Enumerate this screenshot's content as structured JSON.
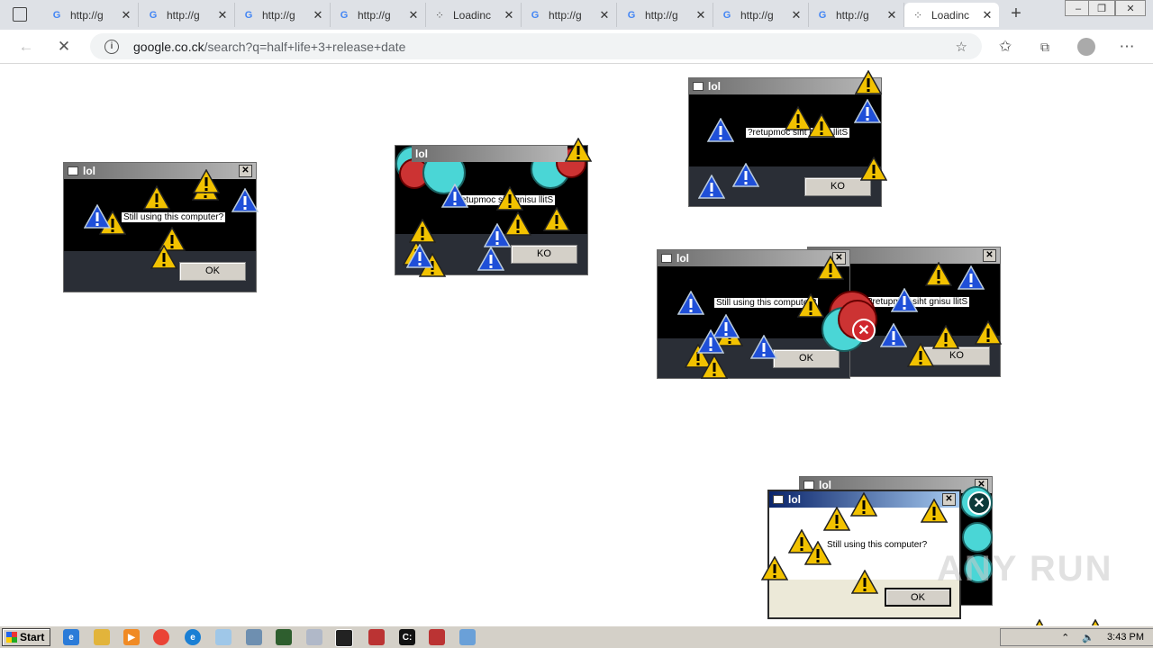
{
  "browser": {
    "tabs": [
      {
        "title": "http://g",
        "icon": "google-icon"
      },
      {
        "title": "http://g",
        "icon": "google-icon"
      },
      {
        "title": "http://g",
        "icon": "google-icon"
      },
      {
        "title": "http://g",
        "icon": "google-icon"
      },
      {
        "title": "Loadinc",
        "icon": "loading-icon"
      },
      {
        "title": "http://g",
        "icon": "google-icon"
      },
      {
        "title": "http://g",
        "icon": "google-icon"
      },
      {
        "title": "http://g",
        "icon": "google-icon"
      },
      {
        "title": "http://g",
        "icon": "google-icon"
      },
      {
        "title": "Loadinc",
        "icon": "loading-icon",
        "active": true
      }
    ],
    "url_domain": "google.co.ck",
    "url_path": "/search?q=half+life+3+release+date"
  },
  "dialogs": [
    {
      "title": "lol",
      "message": "Still using this computer?",
      "button": "OK"
    },
    {
      "title": "lol",
      "message": "?retupmoc siht gnisu llitS",
      "button": "KO"
    },
    {
      "title": "lol",
      "message": "?retupmoc siht gnisu llitS",
      "button": "KO"
    },
    {
      "title": "lol",
      "message": "Still using this computer?",
      "button": "OK"
    },
    {
      "title": "",
      "message": "?retupmoc siht gnisu llitS",
      "button": "KO"
    },
    {
      "title": "lol",
      "message": "",
      "button": ""
    },
    {
      "title": "lol",
      "message": "Still using this computer?",
      "button": "OK"
    }
  ],
  "taskbar": {
    "start_label": "Start",
    "clock": "3:43 PM"
  },
  "watermark": "ANY RUN",
  "colors": {
    "warning": "#f2c200",
    "info": "#1f4fd8",
    "error": "#d0262d"
  }
}
